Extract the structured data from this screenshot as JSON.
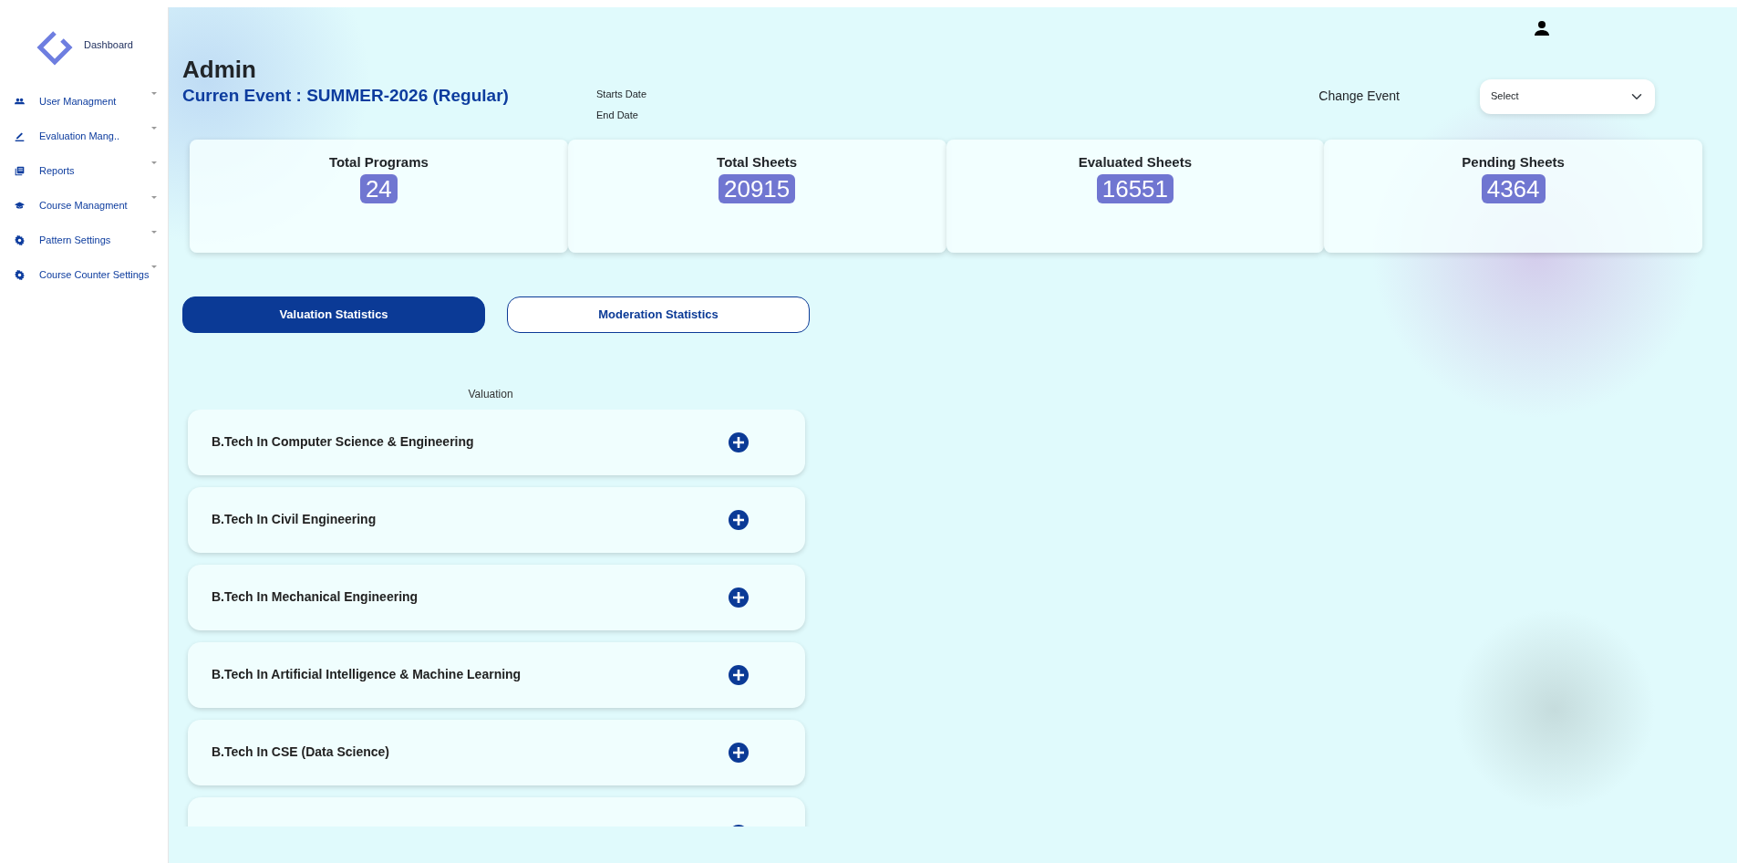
{
  "sidebar": {
    "brand": "Dashboard",
    "items": [
      {
        "label": "User Managment"
      },
      {
        "label": "Evaluation Mang.."
      },
      {
        "label": "Reports"
      },
      {
        "label": "Course Managment"
      },
      {
        "label": "Pattern Settings"
      },
      {
        "label": "Course Counter Settings"
      }
    ]
  },
  "header": {
    "title": "Admin",
    "event": "Curren Event : SUMMER-2026 (Regular)",
    "starts_label": "Starts Date",
    "end_label": "End Date",
    "change_label": "Change Event",
    "select": {
      "value": "Select"
    }
  },
  "stats": [
    {
      "title": "Total Programs",
      "value": "24"
    },
    {
      "title": "Total Sheets",
      "value": "20915"
    },
    {
      "title": "Evaluated Sheets",
      "value": "16551"
    },
    {
      "title": "Pending Sheets",
      "value": "4364"
    }
  ],
  "tabs": [
    {
      "label": "Valuation Statistics",
      "selected": true
    },
    {
      "label": "Moderation Statistics",
      "selected": false
    }
  ],
  "section_title": "Valuation",
  "programs": [
    {
      "name": "B.Tech In Computer Science & Engineering"
    },
    {
      "name": "B.Tech In Civil Engineering"
    },
    {
      "name": "B.Tech In Mechanical Engineering"
    },
    {
      "name": "B.Tech In Artificial Intelligence & Machine Learning"
    },
    {
      "name": "B.Tech In CSE (Data Science)"
    }
  ]
}
